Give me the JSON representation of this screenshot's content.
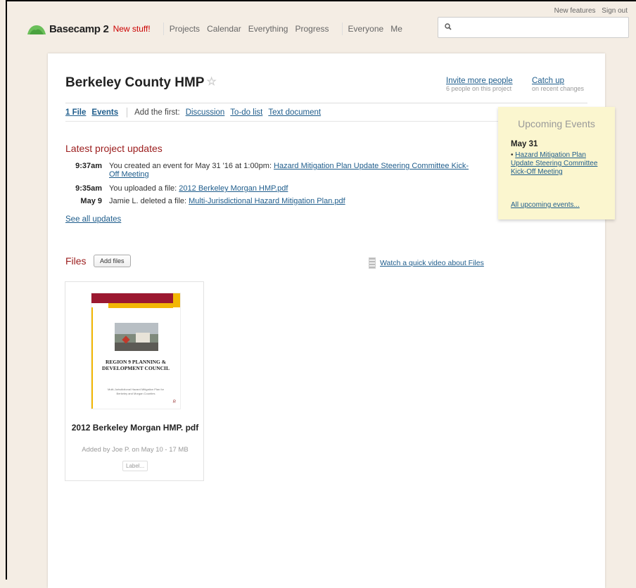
{
  "top_links": {
    "new_features": "New features",
    "sign_out": "Sign out"
  },
  "header": {
    "app_name": "Basecamp 2",
    "new_stuff": "New stuff!",
    "nav": [
      "Projects",
      "Calendar",
      "Everything",
      "Progress"
    ],
    "nav2": [
      "Everyone",
      "Me"
    ]
  },
  "search": {
    "placeholder": ""
  },
  "project": {
    "title": "Berkeley County HMP",
    "invite_label": "Invite more people",
    "invite_sub": "6 people on this project",
    "catchup_label": "Catch up",
    "catchup_sub": "on recent changes"
  },
  "tabs": {
    "files": "1 File",
    "events": "Events",
    "add_first": "Add the first:",
    "discussion": "Discussion",
    "todo": "To-do list",
    "text_doc": "Text document"
  },
  "updates": {
    "heading": "Latest project updates",
    "rows": [
      {
        "time": "9:37am",
        "prefix": "You created an event for May 31 '16 at 1:00pm: ",
        "link": "Hazard Mitigation Plan Update Steering Committee Kick-Off Meeting"
      },
      {
        "time": "9:35am",
        "prefix": "You uploaded a file: ",
        "link": "2012 Berkeley Morgan HMP.pdf"
      },
      {
        "time": "May 9",
        "prefix": "Jamie L. deleted a file: ",
        "link": "Multi-Jurisdictional Hazard Mitigation Plan.pdf"
      }
    ],
    "see_all": "See all updates"
  },
  "files": {
    "heading": "Files",
    "add_button": "Add files",
    "video_link": "Watch a quick video about Files",
    "items": [
      {
        "name": "2012 Berkeley Morgan HMP. pdf",
        "meta": "Added by Joe P. on May 10 - 17 MB",
        "label_button": "Label...",
        "thumb_title": "REGION 9 PLANNING & DEVELOPMENT COUNCIL",
        "thumb_sub": "Multi-Jurisdictional Hazard Mitigation Plan for Berkeley and Morgan Counties"
      }
    ]
  },
  "events": {
    "heading": "Upcoming Events",
    "date": "May 31",
    "item": "Hazard Mitigation Plan Update Steering Committee Kick-Off Meeting",
    "all_link": "All upcoming events..."
  },
  "colors": {
    "accent_red": "#9b1c1c",
    "link_blue": "#1f5d8c",
    "background": "#f4ede4",
    "sticky": "#fbf6cf"
  }
}
